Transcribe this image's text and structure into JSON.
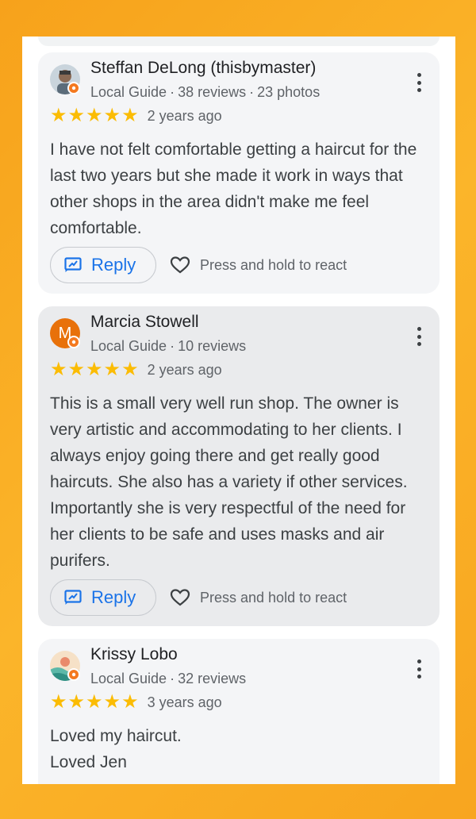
{
  "reviews": [
    {
      "name": "Steffan DeLong (thisbymaster)",
      "local_guide": "Local Guide",
      "reviews": "38 reviews",
      "photos": "23 photos",
      "rating": 5,
      "time_ago": "2 years ago",
      "text": "I have not felt comfortable getting a haircut for the last two years but she made it work in ways that other shops in the area didn't make me feel comfortable.",
      "avatar_letter": ""
    },
    {
      "name": "Marcia Stowell",
      "local_guide": "Local Guide",
      "reviews": "10 reviews",
      "photos": "",
      "rating": 5,
      "time_ago": "2 years ago",
      "text": "This is a small very well run shop. The owner is very artistic and accommodating to her clients. I always enjoy going there and get really good haircuts. She also has a variety if other services. Importantly she is very respectful of the need for her clients to be safe and uses masks and air purifers.",
      "avatar_letter": "M"
    },
    {
      "name": "Krissy Lobo",
      "local_guide": "Local Guide",
      "reviews": "32 reviews",
      "photos": "",
      "rating": 5,
      "time_ago": "3 years ago",
      "text_line1": "Loved my haircut.",
      "text_line2": "Loved Jen",
      "avatar_letter": ""
    }
  ],
  "actions": {
    "reply_label": "Reply",
    "react_label": "Press and hold to react"
  },
  "stars_text": "★",
  "colors": {
    "star": "#fbbc04",
    "accent": "#1a73e8",
    "badge": "#f4791f",
    "background": "#fbb52a"
  }
}
